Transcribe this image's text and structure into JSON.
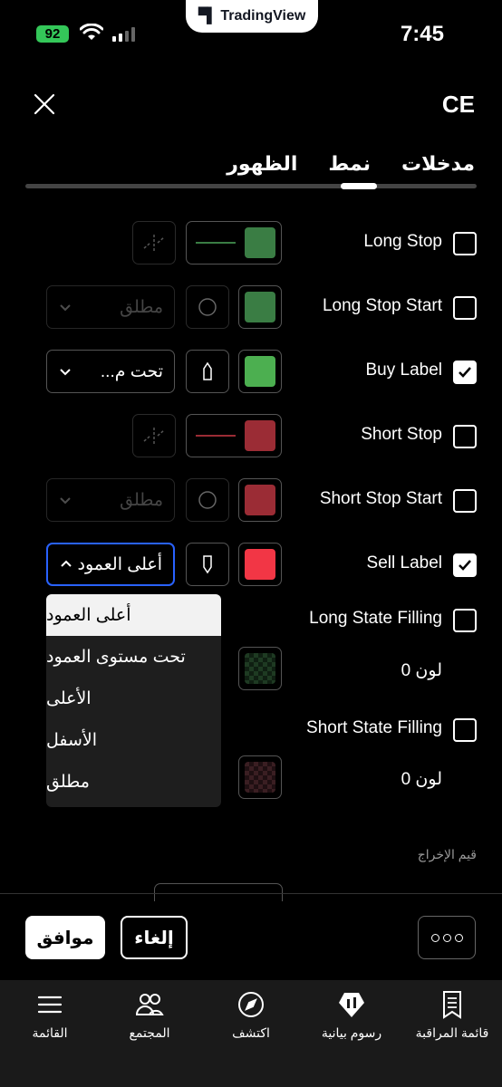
{
  "status_bar": {
    "battery": "92",
    "time": "7:45",
    "app_pill": "TradingView"
  },
  "header": {
    "title": "CE"
  },
  "tabs": [
    {
      "label": "مدخلات"
    },
    {
      "label": "نمط"
    },
    {
      "label": "الظهور"
    }
  ],
  "rows": [
    {
      "label": "Long Stop",
      "checked": false,
      "color": "#3a7d44"
    },
    {
      "label": "Long Stop Start",
      "checked": false,
      "color": "#3a7d44",
      "select": "مطلق"
    },
    {
      "label": "Buy Label",
      "checked": true,
      "color": "#4caf50",
      "select": "تحت م..."
    },
    {
      "label": "Short Stop",
      "checked": false,
      "color": "#9b2c35"
    },
    {
      "label": "Short Stop Start",
      "checked": false,
      "color": "#9b2c35",
      "select": "مطلق"
    },
    {
      "label": "Sell Label",
      "checked": true,
      "color": "#f23645",
      "select": "أعلى العمود"
    },
    {
      "label": "Long State Filling",
      "checked": false
    },
    {
      "label": "لون 0"
    },
    {
      "label": "Short State Filling",
      "checked": false
    },
    {
      "label": "لون 0"
    }
  ],
  "dropdown": {
    "options": [
      "أعلى العمود",
      "تحت مستوى العمود",
      "الأعلى",
      "الأسفل",
      "مطلق"
    ],
    "selected": "أعلى العمود"
  },
  "output_values_label": "قيم الإخراج",
  "footer": {
    "ok": "موافق",
    "cancel": "إلغاء"
  },
  "tabbar": [
    {
      "label": "القائمة",
      "icon": "menu-icon"
    },
    {
      "label": "المجتمع",
      "icon": "community-icon"
    },
    {
      "label": "اكتشف",
      "icon": "compass-icon"
    },
    {
      "label": "رسوم بيانية",
      "icon": "chart-icon"
    },
    {
      "label": "قائمة المراقبة",
      "icon": "watchlist-icon"
    }
  ]
}
